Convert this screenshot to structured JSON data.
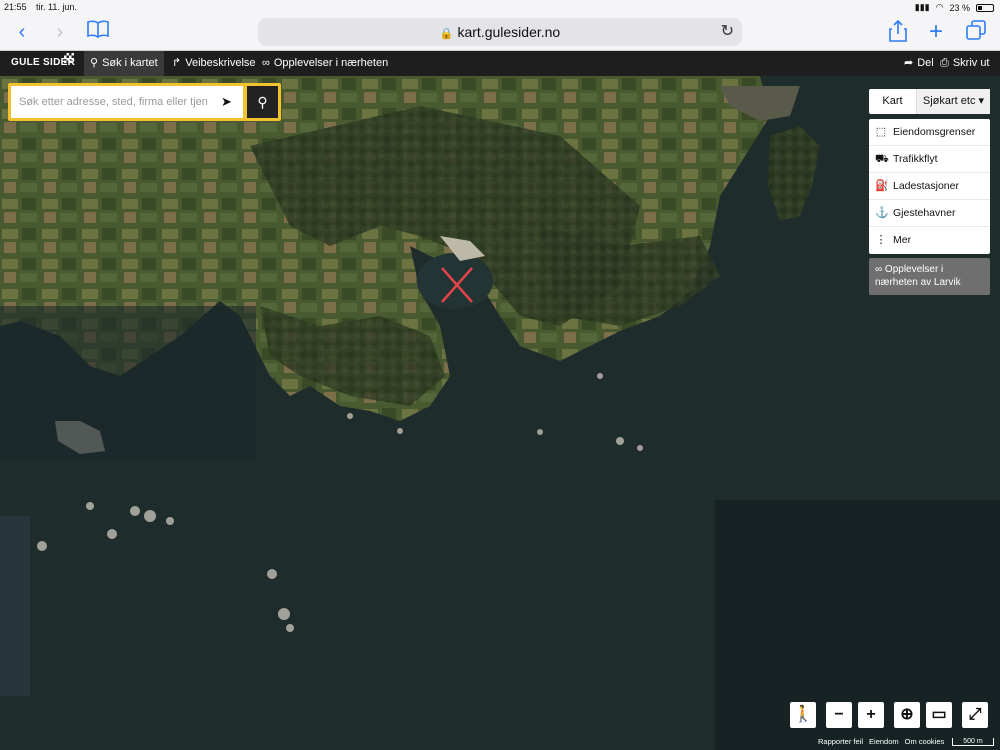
{
  "status_bar": {
    "time": "21:55",
    "date": "tir. 11. jun.",
    "battery": "23 %"
  },
  "browser": {
    "url": "kart.gulesider.no",
    "back_icon": "chevron-left-icon",
    "forward_icon": "chevron-right-icon"
  },
  "app_nav": {
    "logo": "GULE SIDER",
    "tabs": [
      {
        "label": "Søk i kartet",
        "icon": "search-icon",
        "active": true
      },
      {
        "label": "Veibeskrivelse",
        "icon": "directions-icon",
        "active": false
      },
      {
        "label": "Opplevelser i nærheten",
        "icon": "binoculars-icon",
        "active": false
      }
    ],
    "share_label": "Del",
    "print_label": "Skriv ut"
  },
  "search": {
    "placeholder": "Søk etter adresse, sted, firma eller tjen"
  },
  "map_type": {
    "kart_label": "Kart",
    "selected": "Sjøkart etc"
  },
  "layers": [
    {
      "label": "Eiendomsgrenser",
      "icon": "property-icon"
    },
    {
      "label": "Trafikkflyt",
      "icon": "car-icon"
    },
    {
      "label": "Ladestasjoner",
      "icon": "charging-icon"
    },
    {
      "label": "Gjestehavner",
      "icon": "anchor-icon"
    },
    {
      "label": "Mer",
      "icon": "more-icon"
    }
  ],
  "experiences_panel": {
    "label": "Opplevelser i nærheten av Larvik"
  },
  "footer": {
    "report": "Rapporter feil",
    "property": "Eiendom",
    "cookies": "Om cookies",
    "scale": "500 m"
  },
  "colors": {
    "brand_yellow": "#f2c22e",
    "nav_dark": "#1e1e1e",
    "sea": "#1f2a2b",
    "land": "#3d4a2a",
    "marker": "#e0434a"
  }
}
